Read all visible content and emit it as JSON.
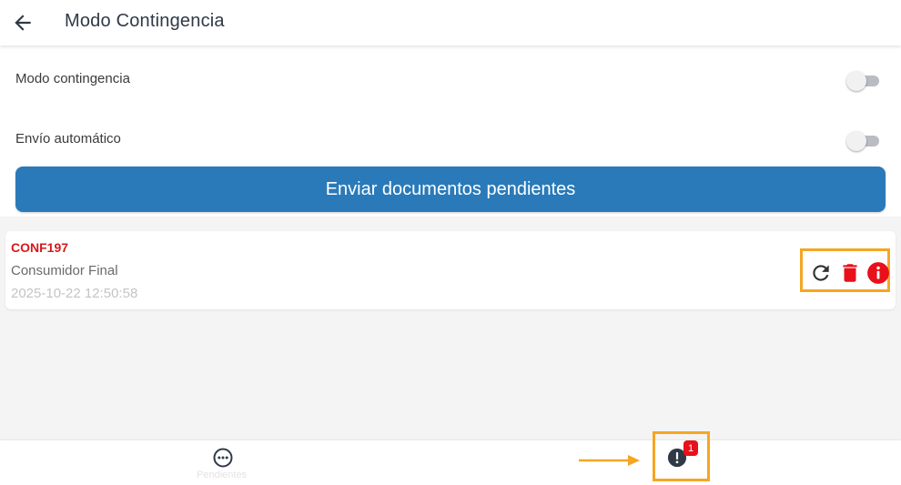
{
  "header": {
    "title": "Modo Contingencia",
    "back_icon": "arrow-left-icon"
  },
  "settings": {
    "contingency_mode": {
      "label": "Modo contingencia",
      "enabled": false
    },
    "auto_send": {
      "label": "Envío automático",
      "enabled": false
    }
  },
  "send_button": {
    "label": "Enviar documentos pendientes"
  },
  "documents": [
    {
      "code": "CONF197",
      "client": "Consumidor Final",
      "date": "2025-10-22 12:50:58",
      "actions": [
        "refresh-icon",
        "trash-icon",
        "info-icon"
      ]
    }
  ],
  "bottom_nav": {
    "items": [
      {
        "label": "Pendientes",
        "icon": "ellipsis-circle-icon"
      },
      {
        "label": "",
        "icon": "alert-circle-icon",
        "badge": "1"
      }
    ]
  },
  "colors": {
    "primary": "#2a7ab9",
    "document_code": "#d8171c",
    "highlight": "#f5a623",
    "badge": "#e8101a"
  }
}
